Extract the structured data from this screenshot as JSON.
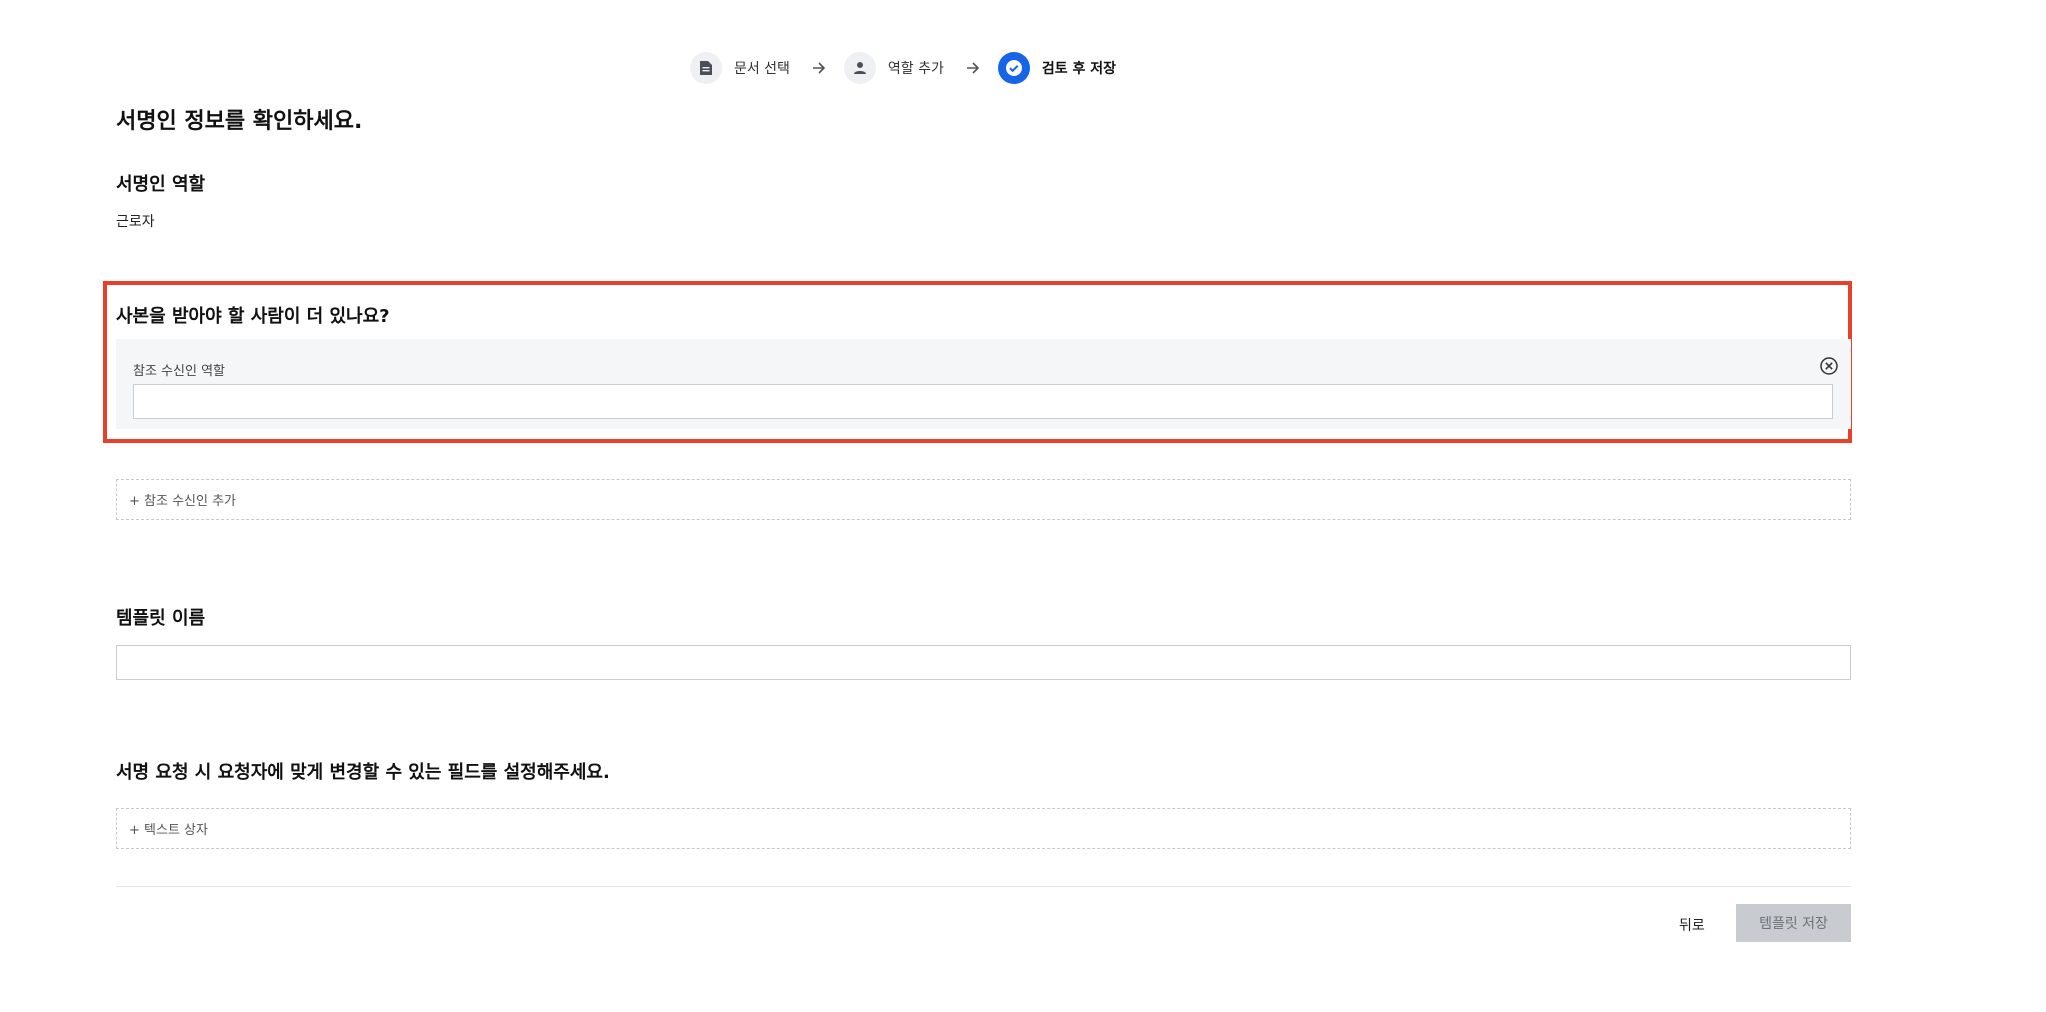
{
  "stepper": {
    "steps": [
      {
        "label": "문서 선택",
        "icon": "document-icon",
        "state": "done"
      },
      {
        "label": "역할 추가",
        "icon": "person-icon",
        "state": "done"
      },
      {
        "label": "검토 후 저장",
        "icon": "check-circle-icon",
        "state": "active"
      }
    ],
    "separator_icon": "arrow-right-icon",
    "active_color": "#1565e6"
  },
  "page_title": "서명인 정보를 확인하세요.",
  "signer_role": {
    "heading": "서명인 역할",
    "value": "근로자"
  },
  "cc_section": {
    "heading": "사본을 받아야 할 사람이 더 있나요?",
    "highlight_color": "#e8402a",
    "recipient": {
      "label": "참조 수신인 역할",
      "value": "",
      "remove_icon": "close-circle-icon"
    },
    "add_label": "+ 참조 수신인 추가"
  },
  "template_name": {
    "heading": "템플릿 이름",
    "value": ""
  },
  "fields": {
    "heading": "서명 요청 시 요청자에 맞게 변경할 수 있는 필드를 설정해주세요.",
    "add_textbox_label": "+ 텍스트 상자"
  },
  "actions": {
    "back_label": "뒤로",
    "save_label": "템플릿 저장",
    "save_disabled": true
  }
}
